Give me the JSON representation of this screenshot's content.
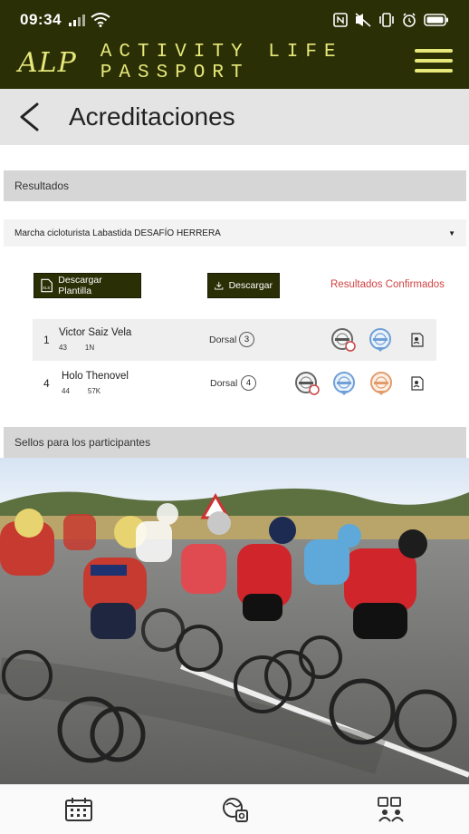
{
  "status_bar": {
    "time": "09:34"
  },
  "header": {
    "logo_text": "ALP",
    "app_name": "ACTIVITY LIFE PASSPORT",
    "brand_color": "#2a2f05",
    "accent_color": "#e6e87a"
  },
  "page": {
    "title": "Acreditaciones"
  },
  "results_section": {
    "heading": "Resultados",
    "event_select_value": "Marcha cicloturista Labastida DESAFÍO HERRERA",
    "download_template_label": "Descargar Plantilla",
    "download_label": "Descargar",
    "confirmed_label": "Resultados Confirmados",
    "confirmed_color": "#d04242",
    "dorsal_label": "Dorsal",
    "rows": [
      {
        "position": "1",
        "name": "Victor Saiz Vela",
        "age": "43",
        "category": "1N",
        "dorsal": "3",
        "badges": [
          "medal-badge-grey",
          "medal-badge-blue"
        ]
      },
      {
        "position": "4",
        "name": "Holo Thenovel",
        "age": "44",
        "category": "57K",
        "dorsal": "4",
        "badges": [
          "medal-badge-grey",
          "medal-badge-blue",
          "medal-badge-orange"
        ]
      }
    ]
  },
  "stamps_section": {
    "heading": "Sellos para los participantes"
  },
  "bottom_nav": {
    "items": [
      "calendar-icon",
      "activity-icon",
      "group-icon"
    ]
  }
}
